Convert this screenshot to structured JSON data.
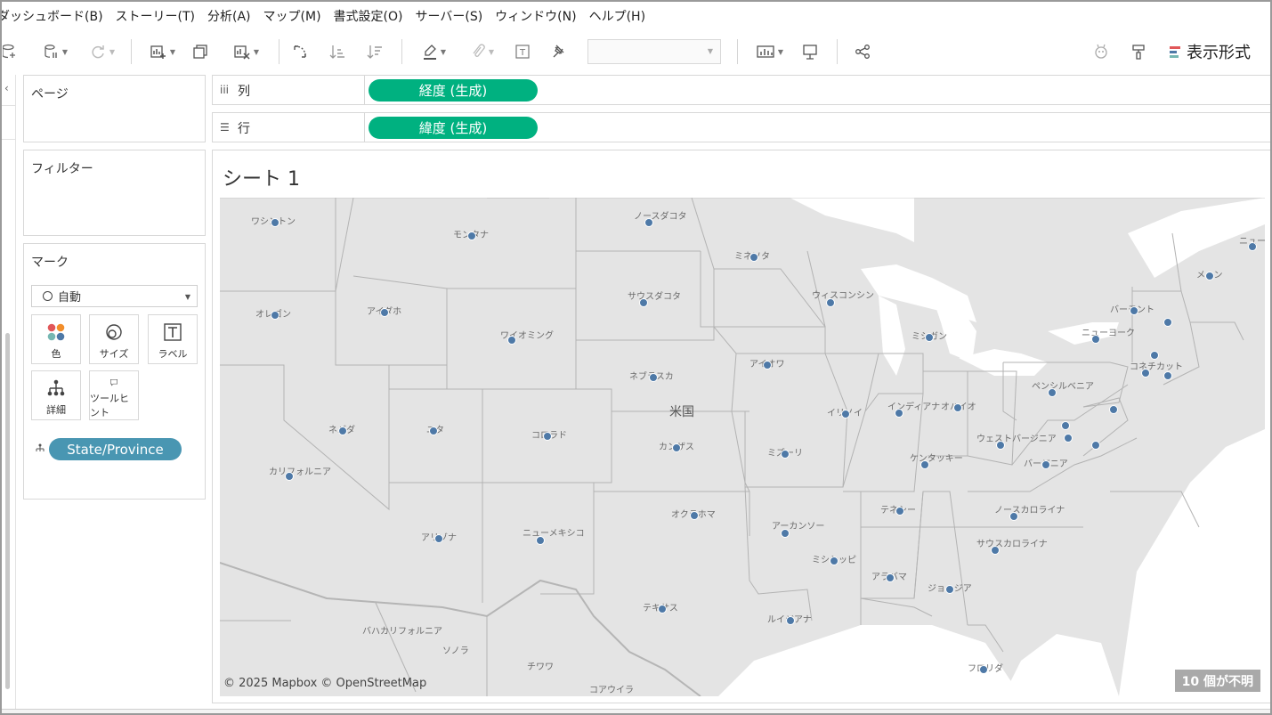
{
  "menu": [
    "ダッシュボード(B)",
    "ストーリー(T)",
    "分析(A)",
    "マップ(M)",
    "書式設定(O)",
    "サーバー(S)",
    "ウィンドウ(N)",
    "ヘルプ(H)"
  ],
  "toolbar": {
    "show_me_label": "表示形式",
    "show_me_colors": [
      "#e15759",
      "#4e79a7",
      "#76b7b2"
    ]
  },
  "cards": {
    "pages_title": "ページ",
    "filters_title": "フィルター",
    "marks_title": "マーク",
    "mark_type": "自動",
    "mark_buttons": [
      "色",
      "サイズ",
      "ラベル",
      "詳細",
      "ツールヒント"
    ],
    "color_icon_colors": [
      "#e15759",
      "#f28e2b",
      "#76b7b2",
      "#4e79a7"
    ],
    "detail_field": "State/Province"
  },
  "shelves": {
    "columns_label": "列",
    "columns_pill": "経度 (生成)",
    "rows_label": "行",
    "rows_pill": "緯度 (生成)"
  },
  "sheet": {
    "title": "シート 1",
    "attribution": "© 2025 Mapbox © OpenStreetMap",
    "unknown_badge": "10 個が不明",
    "country_label": "米国",
    "mark_color": "#4e79a7",
    "map_background": "#e4e4e4",
    "water_color": "#ffffff",
    "state_labels": [
      "ワシントン",
      "オレゴン",
      "カリフォルニア",
      "ネバダ",
      "アイダホ",
      "モンタナ",
      "ワイオミング",
      "ユタ",
      "コロラド",
      "アリゾナ",
      "ニューメキシコ",
      "ノースダコタ",
      "サウスダコタ",
      "ネブラスカ",
      "カンザス",
      "オクラホマ",
      "テキサス",
      "ミネソタ",
      "アイオワ",
      "ミズーリ",
      "アーカンソー",
      "ルイジアナ",
      "ウィスコンシン",
      "イリノイ",
      "ミシガン",
      "インディアナ",
      "オハイオ",
      "ケンタッキー",
      "テネシー",
      "ミシシッピ",
      "アラバマ",
      "ジョージア",
      "フロリダ",
      "サウスカロライナ",
      "ノースカロライナ",
      "バージニア",
      "ウェストバージニア",
      "ペンシルベニア",
      "ニューヨーク",
      "バーモント",
      "メーン",
      "コネチカット",
      "ニューブランズウィック"
    ],
    "region_labels": [
      "バハカリフォルニア",
      "ソノラ",
      "チワワ",
      "コアウイラ"
    ]
  }
}
